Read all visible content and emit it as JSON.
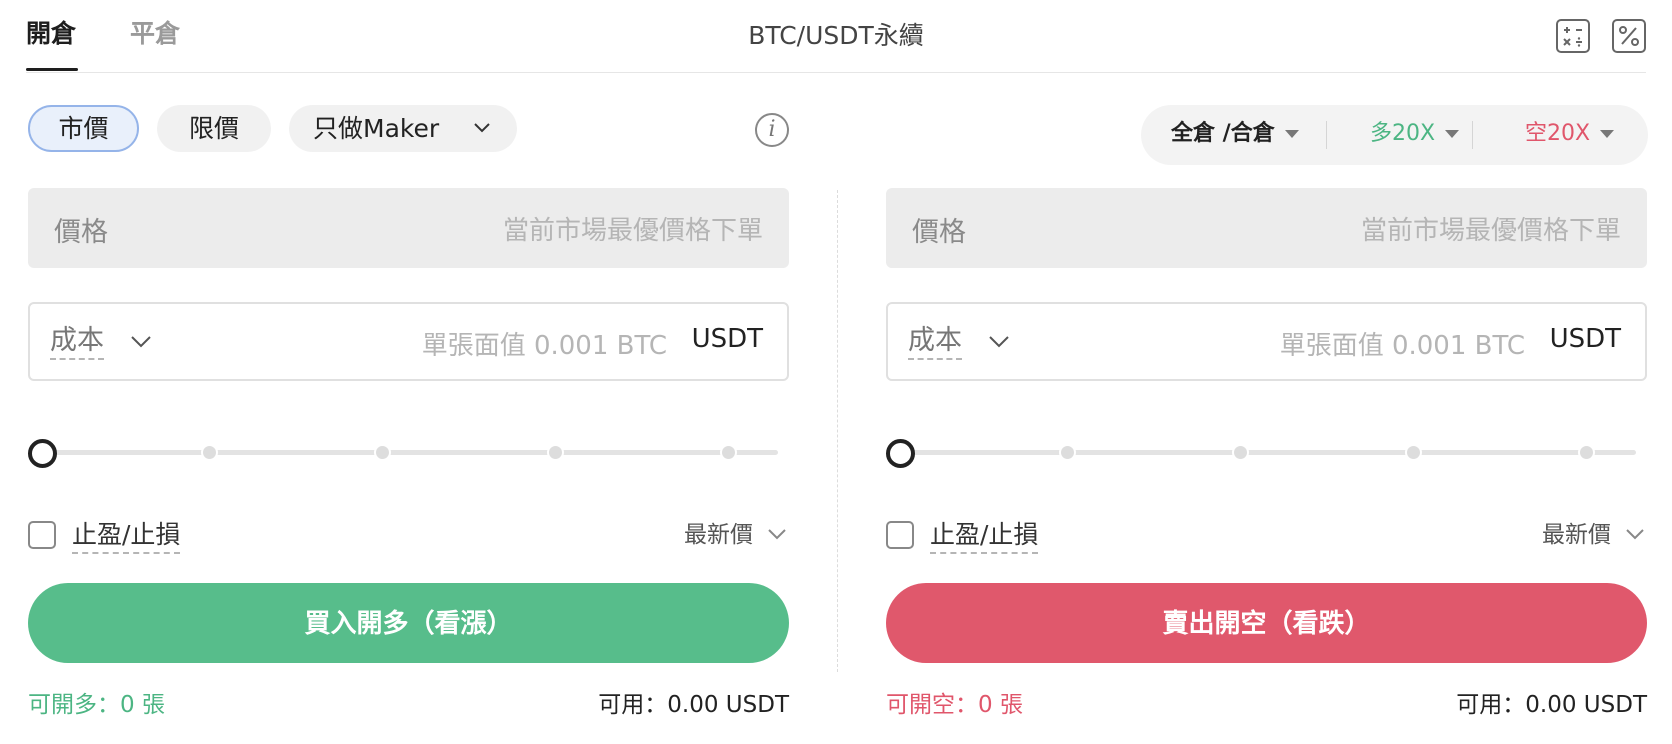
{
  "header": {
    "tabs": [
      {
        "label": "開倉",
        "active": true
      },
      {
        "label": "平倉",
        "active": false
      }
    ],
    "pair_title": "BTC/USDT永續",
    "icons": [
      "calculator-icon",
      "percent-icon"
    ]
  },
  "order_types": {
    "market": "市價",
    "limit": "限價",
    "maker": "只做Maker",
    "selected": "market"
  },
  "margin": {
    "mode": "全倉 /合倉",
    "long_leverage": "多20X",
    "short_leverage": "空20X",
    "long_color": "#4cb583",
    "short_color": "#e0566b"
  },
  "buy_panel": {
    "price_label": "價格",
    "price_placeholder": "當前市場最優價格下單",
    "cost_label": "成本",
    "cost_placeholder": "單張面值 0.001 BTC",
    "cost_unit": "USDT",
    "slider_value_percent": 0,
    "tp_sl_label": "止盈/止損",
    "tp_sl_checked": false,
    "price_type": "最新價",
    "button_label": "買入開多（看漲）",
    "button_color": "#57bd8b",
    "available_open": "可開多：0 張",
    "available_balance": "可用：0.00 USDT"
  },
  "sell_panel": {
    "price_label": "價格",
    "price_placeholder": "當前市場最優價格下單",
    "cost_label": "成本",
    "cost_placeholder": "單張面值 0.001 BTC",
    "cost_unit": "USDT",
    "slider_value_percent": 0,
    "tp_sl_label": "止盈/止損",
    "tp_sl_checked": false,
    "price_type": "最新價",
    "button_label": "賣出開空（看跌）",
    "button_color": "#e0586c",
    "available_open": "可開空：0 張",
    "available_balance": "可用：0.00 USDT"
  }
}
